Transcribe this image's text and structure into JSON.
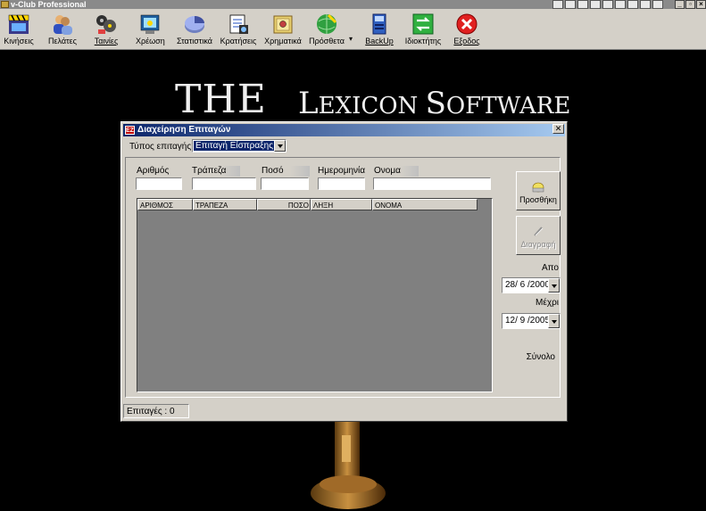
{
  "app": {
    "title": "v-Club Professional"
  },
  "toolbar": {
    "items": [
      {
        "label": "Κινήσεις",
        "icon": "film-clapper-icon"
      },
      {
        "label": "Πελάτες",
        "icon": "customers-icon"
      },
      {
        "label": "Ταινίες",
        "icon": "film-reels-icon"
      },
      {
        "label": "Χρέωση",
        "icon": "charge-icon"
      },
      {
        "label": "Στατιστικά",
        "icon": "pie-chart-icon"
      },
      {
        "label": "Κρατήσεις",
        "icon": "reservations-icon"
      },
      {
        "label": "Χρηματικά",
        "icon": "safe-icon"
      },
      {
        "label": "Πρόσθετα",
        "icon": "globe-tools-icon"
      },
      {
        "label": "BackUp",
        "icon": "backup-icon"
      },
      {
        "label": "Ιδιοκτήτης",
        "icon": "owner-arrows-icon"
      },
      {
        "label": "Εξοδος",
        "icon": "exit-icon"
      }
    ]
  },
  "background": {
    "logo_the": "THE",
    "logo_lexicon_L": "L",
    "logo_lexicon_rest": "EXICON ",
    "logo_software_S": "S",
    "logo_software_rest": "OFTWARE"
  },
  "dialog": {
    "title": "Διαχείρηση Επιταγών",
    "close_glyph": "✕",
    "type_label": "Τύπος επιταγής",
    "type_value": "Επιταγή Είσπραξης",
    "fields": [
      {
        "label": "Αριθμός",
        "value": ""
      },
      {
        "label": "Τράπεζα",
        "value": ""
      },
      {
        "label": "Ποσό",
        "value": ""
      },
      {
        "label": "Ημερομηνία",
        "value": ""
      },
      {
        "label": "Ονομα",
        "value": ""
      }
    ],
    "grid": {
      "columns": [
        "ΑΡΙΘΜΟΣ",
        "ΤΡΑΠΕΖΑ",
        "ΠΟΣΟ",
        "ΛΗΞΗ",
        "ΟΝΟΜΑ"
      ],
      "rows": []
    },
    "add_button": "Προσθήκη",
    "delete_button": "Διαγραφή",
    "from_label": "Απο",
    "from_date": "28/ 6 /2000",
    "to_label": "Μέχρι",
    "to_date": "12/ 9 /2005",
    "total_label": "Σύνολο",
    "status": "Επιταγές : 0"
  }
}
